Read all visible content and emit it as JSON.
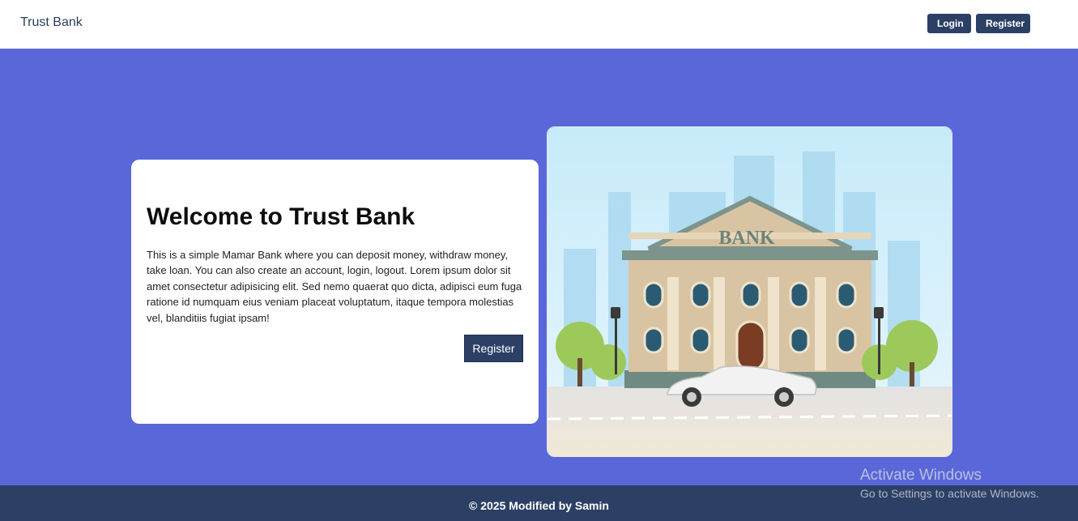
{
  "nav": {
    "brand": "Trust Bank",
    "login_label": "Login",
    "register_label": "Register"
  },
  "hero": {
    "title": "Welcome to Trust Bank",
    "description": "This is a simple Mamar Bank where you can deposit money, withdraw money, take loan. You can also create an account, login, logout. Lorem ipsum dolor sit amet consectetur adipisicing elit. Sed nemo quaerat quo dicta, adipisci eum fuga ratione id numquam eius veniam placeat voluptatum, itaque tempora molestias vel, blanditiis fugiat ipsam!",
    "register_label": "Register",
    "illustration": {
      "sign": "BANK"
    }
  },
  "footer": {
    "text": "© 2025 Modified by Samin"
  },
  "watermark": {
    "title": "Activate Windows",
    "subtitle": "Go to Settings to activate Windows."
  },
  "colors": {
    "primary": "#2c4066",
    "hero_bg": "#5a67d8"
  }
}
